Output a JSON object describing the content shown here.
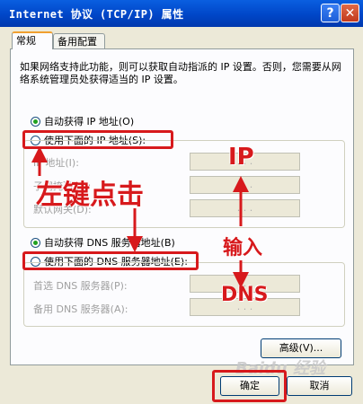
{
  "window": {
    "title": "Internet 协议 (TCP/IP) 属性",
    "help_label": "?",
    "close_label": "✕"
  },
  "tabs": [
    {
      "label": "常规",
      "active": true
    },
    {
      "label": "备用配置",
      "active": false
    }
  ],
  "description": "如果网络支持此功能，则可以获取自动指派的 IP 设置。否则，您需要从网络系统管理员处获得适当的 IP 设置。",
  "ip_options": {
    "auto_label": "自动获得 IP 地址(O)",
    "manual_label": "使用下面的 IP 地址(S):",
    "selected": "auto"
  },
  "ip_fields": [
    {
      "label": "IP 地址(I):",
      "value": ". . ."
    },
    {
      "label": "子网掩码(U):",
      "value": ". . ."
    },
    {
      "label": "默认网关(D):",
      "value": ". . ."
    }
  ],
  "dns_options": {
    "auto_label": "自动获得 DNS 服务器地址(B)",
    "manual_label": "使用下面的 DNS 服务器地址(E):",
    "selected": "auto"
  },
  "dns_fields": [
    {
      "label": "首选 DNS 服务器(P):",
      "value": ". . ."
    },
    {
      "label": "备用 DNS 服务器(A):",
      "value": ". . ."
    }
  ],
  "buttons": {
    "advanced": "高级(V)...",
    "ok": "确定",
    "cancel": "取消"
  },
  "annotations": {
    "left_click": "左键点击",
    "ip": "IP",
    "input": "输入",
    "dns": "DNS",
    "color": "#d7191c"
  },
  "watermark": "Baidu 经验"
}
